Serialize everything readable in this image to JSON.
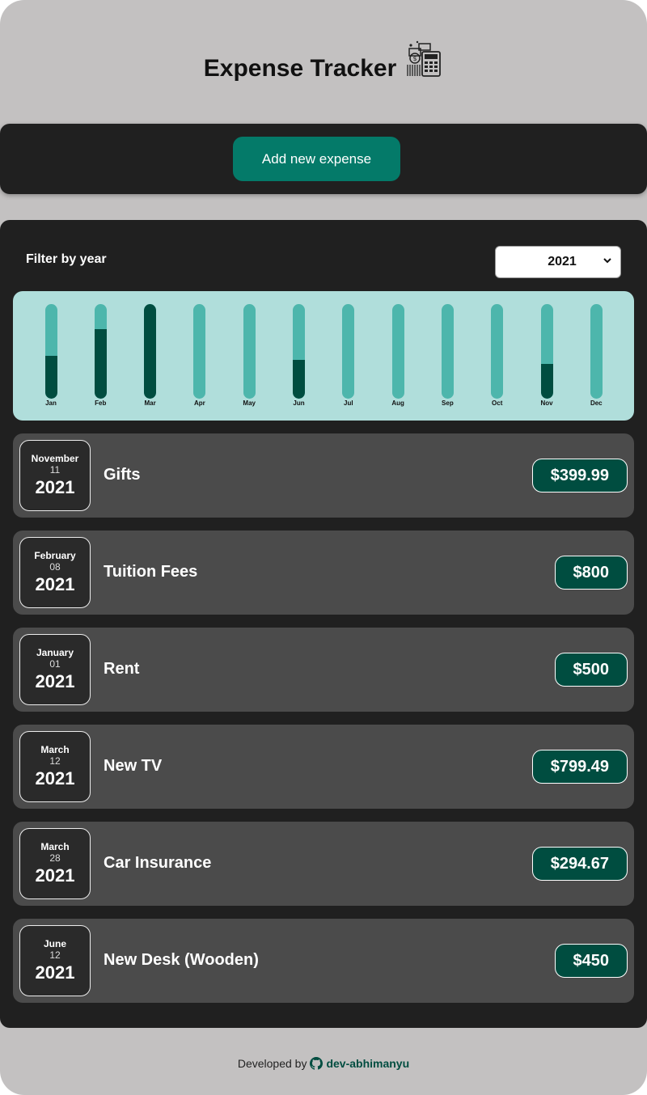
{
  "app": {
    "title": "Expense Tracker",
    "logo_icon": "calculator-money-icon"
  },
  "actions": {
    "add_label": "Add new expense"
  },
  "filter": {
    "label": "Filter by year",
    "selected_year": "2021"
  },
  "chart_data": {
    "type": "bar",
    "categories": [
      "Jan",
      "Feb",
      "Mar",
      "Apr",
      "May",
      "Jun",
      "Jul",
      "Aug",
      "Sep",
      "Oct",
      "Nov",
      "Dec"
    ],
    "values": [
      500,
      800,
      1094.16,
      0,
      0,
      450,
      0,
      0,
      0,
      0,
      399.99,
      0
    ],
    "max_value": 1094.16,
    "colors": {
      "track": "#4db6ac",
      "fill": "#004d40",
      "background": "#b0dedb"
    }
  },
  "expenses": [
    {
      "month": "November",
      "day": "11",
      "year": "2021",
      "title": "Gifts",
      "amount": "$399.99"
    },
    {
      "month": "February",
      "day": "08",
      "year": "2021",
      "title": "Tuition Fees",
      "amount": "$800"
    },
    {
      "month": "January",
      "day": "01",
      "year": "2021",
      "title": "Rent",
      "amount": "$500"
    },
    {
      "month": "March",
      "day": "12",
      "year": "2021",
      "title": "New TV",
      "amount": "$799.49"
    },
    {
      "month": "March",
      "day": "28",
      "year": "2021",
      "title": "Car Insurance",
      "amount": "$294.67"
    },
    {
      "month": "June",
      "day": "12",
      "year": "2021",
      "title": "New Desk (Wooden)",
      "amount": "$450"
    }
  ],
  "footer": {
    "prefix": "Developed by",
    "link_text": "dev-abhimanyu",
    "icon": "github-icon"
  },
  "colors": {
    "page_bg": "#c3c1c1",
    "panel_bg": "#202020",
    "accent": "#047a69",
    "price_bg": "#004d40",
    "item_bg": "#4b4b4b"
  }
}
